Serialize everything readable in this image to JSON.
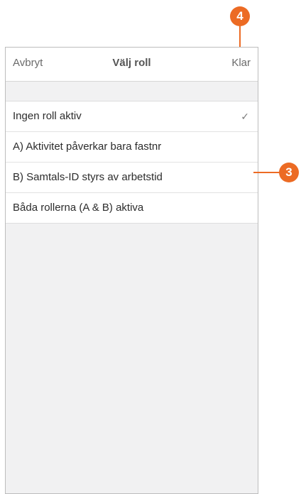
{
  "navbar": {
    "cancel_label": "Avbryt",
    "title": "Välj roll",
    "done_label": "Klar"
  },
  "roles": [
    {
      "label": "Ingen roll aktiv",
      "selected": true
    },
    {
      "label": "A) Aktivitet påverkar bara fastnr",
      "selected": false
    },
    {
      "label": "B) Samtals-ID styrs av arbetstid",
      "selected": false
    },
    {
      "label": "Båda rollerna (A & B) aktiva",
      "selected": false
    }
  ],
  "check_glyph": "✓",
  "callouts": [
    {
      "number": "4",
      "target": "done-button"
    },
    {
      "number": "3",
      "target": "role-list"
    }
  ],
  "colors": {
    "callout": "#ec6b24",
    "background": "#f1f1f2"
  }
}
